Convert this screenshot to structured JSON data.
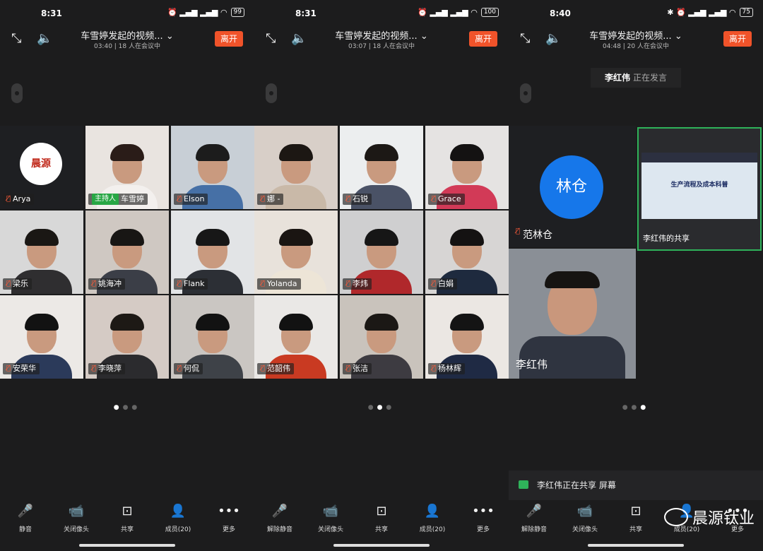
{
  "screens": [
    {
      "time": "8:31",
      "battery": "99",
      "title": "车雪婷发起的视频...",
      "subtitle": "03:40 | 18 人在会议中",
      "leave": "离开",
      "tiles": [
        {
          "name": "Arya",
          "kind": "logo",
          "logo_text": "晨源"
        },
        {
          "name": "车雪婷",
          "host": "主持人",
          "bg": "#e9e4e0",
          "body": "#f3f0ee",
          "hair": "#2a1c18"
        },
        {
          "name": "Elson",
          "bg": "#c8cfd6",
          "body": "#4670a6",
          "hair": "#1c1c1c"
        },
        {
          "name": "梁乐",
          "bg": "#d8d8d8",
          "body": "#2f2e30",
          "hair": "#1a1714"
        },
        {
          "name": "姚海冲",
          "bg": "#cfc8c2",
          "body": "#3b3e47",
          "hair": "#181614"
        },
        {
          "name": "Flank",
          "bg": "#e2e4e6",
          "body": "#2c2f35",
          "hair": "#171717"
        },
        {
          "name": "安荣华",
          "bg": "#ece9e6",
          "body": "#2b3a5a",
          "hair": "#121212"
        },
        {
          "name": "李晓萍",
          "bg": "#d5cbc5",
          "body": "#2b2b2e",
          "hair": "#1d1915"
        },
        {
          "name": "何侃",
          "bg": "#cac6c2",
          "body": "#3e4248",
          "hair": "#121212"
        }
      ],
      "page_index": 0
    },
    {
      "time": "8:31",
      "battery": "100",
      "title": "车雪婷发起的视频...",
      "subtitle": "03:07 | 18 人在会议中",
      "leave": "离开",
      "tiles": [
        {
          "name": "娜 -",
          "bg": "#d8cfc8",
          "body": "#c9b9a8",
          "hair": "#1c1713"
        },
        {
          "name": "石锐",
          "bg": "#eceeef",
          "body": "#4a5266",
          "hair": "#1c1815"
        },
        {
          "name": "Grace",
          "bg": "#e5e3e2",
          "body": "#d23a57",
          "hair": "#141212"
        },
        {
          "name": "Yolanda",
          "bg": "#e8e2db",
          "body": "#ede5d7",
          "hair": "#1a1512"
        },
        {
          "name": "李炜",
          "bg": "#cfcfd0",
          "body": "#b0282b",
          "hair": "#161616"
        },
        {
          "name": "白娟",
          "bg": "#d7d5d4",
          "body": "#1e2a3e",
          "hair": "#141212"
        },
        {
          "name": "范韶伟",
          "bg": "#eae8e6",
          "body": "#c93a22",
          "hair": "#121212"
        },
        {
          "name": "张洁",
          "bg": "#c9c3bc",
          "body": "#3d3b41",
          "hair": "#1b1815"
        },
        {
          "name": "杨林辉",
          "bg": "#ebe7e3",
          "body": "#1f2a44",
          "hair": "#141414"
        }
      ],
      "page_index": 1
    },
    {
      "time": "8:40",
      "battery": "75",
      "title": "车雪婷发起的视频...",
      "subtitle": "04:48 | 20 人在会议中",
      "leave": "离开",
      "speaker_name": "李红伟",
      "speaker_text": "正在发言",
      "avatar_text": "林仓",
      "avatar_name": "范林仓",
      "slide_title": "生产流程及成本科普",
      "share_label": "李红伟的共享",
      "live_name": "李红伟",
      "share_note": "李红伟正在共享 屏幕",
      "watermark": "晨源钛业",
      "page_index": 2
    }
  ],
  "toolbar": [
    {
      "icon": "🎤",
      "label": "静音"
    },
    {
      "icon": "📹",
      "label": "关闭像头"
    },
    {
      "icon": "⊡",
      "label": "共享"
    },
    {
      "icon": "👤",
      "label": "成员(20)"
    },
    {
      "icon": "•••",
      "label": "更多"
    }
  ],
  "toolbar_p2_mic_label": "解除静音",
  "colors": {
    "leave": "#f0532a",
    "host": "#28a745",
    "avatar": "#1677ea",
    "share_border": "#2fb25a"
  }
}
